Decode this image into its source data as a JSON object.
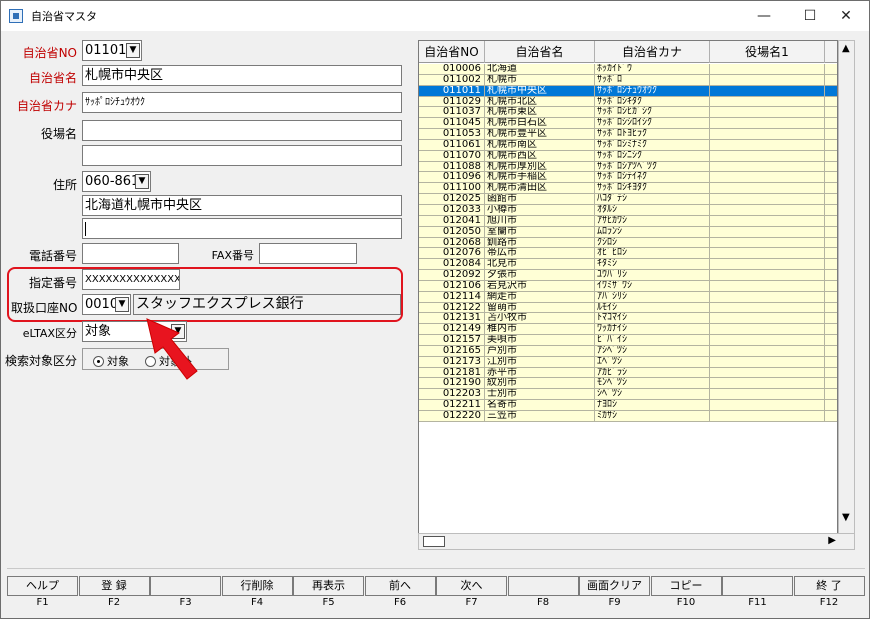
{
  "window": {
    "title": "自治省マスタ",
    "min_glyph": "—",
    "max_glyph": "☐",
    "close_glyph": "✕"
  },
  "form": {
    "no_label": "自治省NO",
    "no_value": "011011",
    "name_label": "自治省名",
    "name_value": "札幌市中央区",
    "kana_label": "自治省カナ",
    "kana_value": "ｻｯﾎﾟﾛｼﾁｭｳｵｳｸ",
    "yakuba_label": "役場名",
    "yakuba_value": "",
    "yakuba_value2": "",
    "address_label": "住所",
    "zip_value": "060-8612",
    "address1": "北海道札幌市中央区",
    "address2": "",
    "tel_label": "電話番号",
    "tel_value": "",
    "fax_label": "FAX番号",
    "fax_value": "",
    "designated_label": "指定番号",
    "designated_value": "XXXXXXXXXXXXXX",
    "account_label": "取扱口座NO",
    "account_value": "0010",
    "account_name": "スタッフエクスプレス銀行",
    "eltax_label": "eLTAX区分",
    "eltax_value": "対象",
    "search_label": "検索対象区分",
    "search_opt1": "対象",
    "search_opt2": "対象外"
  },
  "grid": {
    "headers": [
      "自治省NO",
      "自治省名",
      "自治省カナ",
      "役場名1"
    ],
    "rows": [
      [
        "010006",
        "北海道",
        "ﾎｯｶｲﾄﾞｳ"
      ],
      [
        "011002",
        "札幌市",
        "ｻｯﾎﾟﾛ"
      ],
      [
        "011011",
        "札幌市中央区",
        "ｻｯﾎﾟﾛｼﾁｭｳｵｳｸ"
      ],
      [
        "011029",
        "札幌市北区",
        "ｻｯﾎﾟﾛｼｷﾀｸ"
      ],
      [
        "011037",
        "札幌市東区",
        "ｻｯﾎﾟﾛｼﾋｶﾞｼｸ"
      ],
      [
        "011045",
        "札幌市白石区",
        "ｻｯﾎﾟﾛｼｼﾛｲｼｸ"
      ],
      [
        "011053",
        "札幌市豊平区",
        "ｻｯﾎﾟﾛﾄﾖﾋﾗｸ"
      ],
      [
        "011061",
        "札幌市南区",
        "ｻｯﾎﾟﾛｼﾐﾅﾐｸ"
      ],
      [
        "011070",
        "札幌市西区",
        "ｻｯﾎﾟﾛｼﾆｼｸ"
      ],
      [
        "011088",
        "札幌市厚別区",
        "ｻｯﾎﾟﾛｼｱﾂﾍﾞﾂｸ"
      ],
      [
        "011096",
        "札幌市手稲区",
        "ｻｯﾎﾟﾛｼﾃｲﾈｸ"
      ],
      [
        "011100",
        "札幌市清田区",
        "ｻｯﾎﾟﾛｼｷﾖﾀｸ"
      ],
      [
        "012025",
        "函館市",
        "ﾊｺﾀﾞﾃｼ"
      ],
      [
        "012033",
        "小樽市",
        "ｵﾀﾙｼ"
      ],
      [
        "012041",
        "旭川市",
        "ｱｻﾋｶﾜｼ"
      ],
      [
        "012050",
        "室蘭市",
        "ﾑﾛﾗﾝｼ"
      ],
      [
        "012068",
        "釧路市",
        "ｸｼﾛｼ"
      ],
      [
        "012076",
        "帯広市",
        "ｵﾋﾞﾋﾛｼ"
      ],
      [
        "012084",
        "北見市",
        "ｷﾀﾐｼ"
      ],
      [
        "012092",
        "夕張市",
        "ﾕｳﾊﾞﾘｼ"
      ],
      [
        "012106",
        "岩見沢市",
        "ｲﾜﾐｻﾞﾜｼ"
      ],
      [
        "012114",
        "網走市",
        "ｱﾊﾞｼﾘｼ"
      ],
      [
        "012122",
        "留萌市",
        "ﾙﾓｲｼ"
      ],
      [
        "012131",
        "苫小牧市",
        "ﾄﾏｺﾏｲｼ"
      ],
      [
        "012149",
        "稚内市",
        "ﾜｯｶﾅｲｼ"
      ],
      [
        "012157",
        "美唄市",
        "ﾋﾞﾊﾞｲｼ"
      ],
      [
        "012165",
        "芦別市",
        "ｱｼﾍﾞﾂｼ"
      ],
      [
        "012173",
        "江別市",
        "ｴﾍﾞﾂｼ"
      ],
      [
        "012181",
        "赤平市",
        "ｱｶﾋﾞﾗｼ"
      ],
      [
        "012190",
        "紋別市",
        "ﾓﾝﾍﾞﾂｼ"
      ],
      [
        "012203",
        "士別市",
        "ｼﾍﾞﾂｼ"
      ],
      [
        "012211",
        "名寄市",
        "ﾅﾖﾛｼ"
      ],
      [
        "012220",
        "三笠市",
        "ﾐｶｻｼ"
      ]
    ],
    "selected_index": 2
  },
  "fkeys": [
    {
      "label": "ヘルプ",
      "key": "F1"
    },
    {
      "label": "登 録",
      "key": "F2"
    },
    {
      "label": "",
      "key": "F3"
    },
    {
      "label": "行削除",
      "key": "F4"
    },
    {
      "label": "再表示",
      "key": "F5"
    },
    {
      "label": "前へ",
      "key": "F6"
    },
    {
      "label": "次へ",
      "key": "F7"
    },
    {
      "label": "",
      "key": "F8"
    },
    {
      "label": "画面クリア",
      "key": "F9"
    },
    {
      "label": "コピー",
      "key": "F10"
    },
    {
      "label": "",
      "key": "F11"
    },
    {
      "label": "終 了",
      "key": "F12"
    }
  ],
  "colors": {
    "highlight": "#e0141e",
    "selected_row": "#0078d7",
    "row_bg": "#ffffd6",
    "required_label": "#c00000"
  }
}
